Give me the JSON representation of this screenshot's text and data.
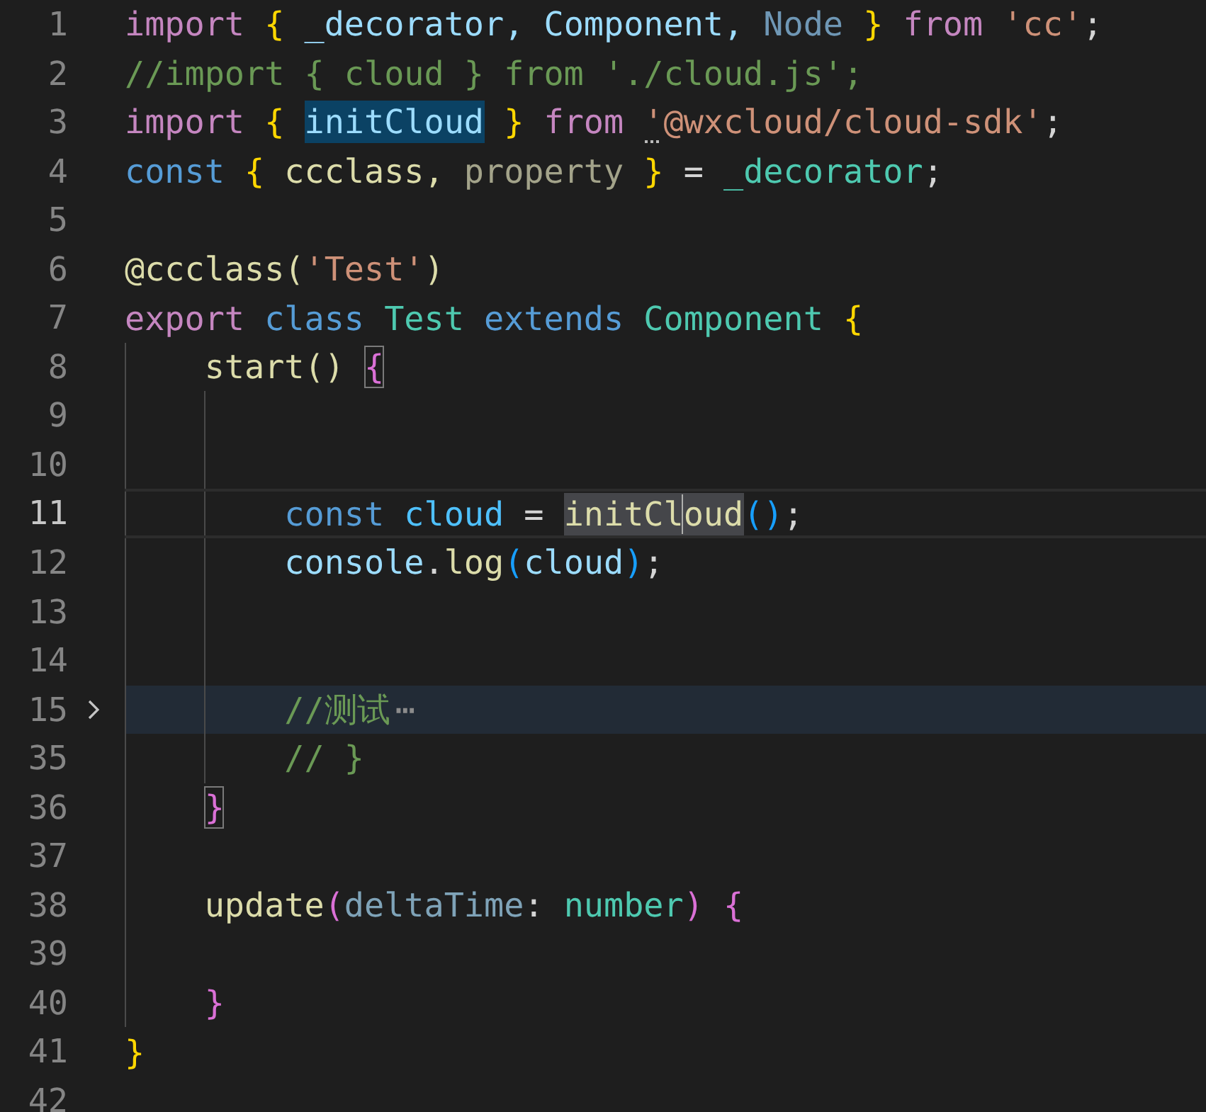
{
  "editor": {
    "lines": [
      {
        "number": "1",
        "current": false,
        "folded": false,
        "tokens": [
          {
            "text": "import",
            "kind": "keyword"
          },
          {
            "text": " {",
            "kind": "brace1"
          },
          {
            "text": " _decorator,",
            "kind": "var"
          },
          {
            "text": " Component,",
            "kind": "var"
          },
          {
            "text": " Node",
            "kind": "faded_var"
          },
          {
            "text": " }",
            "kind": "brace1"
          },
          {
            "text": " from",
            "kind": "keyword"
          },
          {
            "text": " 'cc'",
            "kind": "string"
          },
          {
            "text": ";",
            "kind": "plain"
          }
        ]
      },
      {
        "number": "2",
        "current": false,
        "folded": false,
        "tokens": [
          {
            "text": "//import { cloud } from './cloud.js';",
            "kind": "comment"
          }
        ]
      },
      {
        "number": "3",
        "current": false,
        "folded": false,
        "tokens": [
          {
            "text": "import",
            "kind": "keyword"
          },
          {
            "text": " { ",
            "kind": "brace1"
          },
          {
            "text": "initCloud",
            "kind": "var",
            "match": true
          },
          {
            "text": " }",
            "kind": "brace1"
          },
          {
            "text": " from ",
            "kind": "keyword"
          },
          {
            "text": "'@wxcloud/cloud-sdk'",
            "kind": "string",
            "hint": true
          },
          {
            "text": ";",
            "kind": "plain"
          }
        ]
      },
      {
        "number": "4",
        "current": false,
        "folded": false,
        "tokens": [
          {
            "text": "const",
            "kind": "storage"
          },
          {
            "text": " {",
            "kind": "brace1"
          },
          {
            "text": " ccclass,",
            "kind": "func"
          },
          {
            "text": " property",
            "kind": "faded_func"
          },
          {
            "text": " }",
            "kind": "brace1"
          },
          {
            "text": " =",
            "kind": "plain"
          },
          {
            "text": " _decorator",
            "kind": "type"
          },
          {
            "text": ";",
            "kind": "plain"
          }
        ]
      },
      {
        "number": "5",
        "current": false,
        "folded": false
      },
      {
        "number": "6",
        "current": false,
        "folded": false,
        "tokens": [
          {
            "text": "@ccclass(",
            "kind": "func"
          },
          {
            "text": "'Test'",
            "kind": "string"
          },
          {
            "text": ")",
            "kind": "func"
          }
        ]
      },
      {
        "number": "7",
        "current": false,
        "folded": false,
        "tokens": [
          {
            "text": "export",
            "kind": "keyword"
          },
          {
            "text": " class",
            "kind": "storage"
          },
          {
            "text": " Test",
            "kind": "type"
          },
          {
            "text": " extends",
            "kind": "storage"
          },
          {
            "text": " Component",
            "kind": "type"
          },
          {
            "text": " {",
            "kind": "brace1"
          }
        ],
        "children": [
          {
            "number": "8",
            "current": false,
            "folded": false,
            "tokens": [
              {
                "text": "start() ",
                "kind": "func"
              },
              {
                "text": "{",
                "kind": "brace2",
                "bracket_match": true
              }
            ],
            "children": [
              {
                "number": "9",
                "current": false,
                "folded": false
              },
              {
                "number": "10",
                "current": false,
                "folded": false
              },
              {
                "number": "11",
                "current": true,
                "folded": false,
                "tokens": [
                  {
                    "text": "const",
                    "kind": "storage"
                  },
                  {
                    "text": " cloud",
                    "kind": "const_var"
                  },
                  {
                    "text": " = ",
                    "kind": "plain"
                  },
                  {
                    "text": "initCl",
                    "kind": "func",
                    "occurrence": true,
                    "cursor": true
                  },
                  {
                    "text": "oud",
                    "kind": "func",
                    "occurrence": true
                  },
                  {
                    "text": "()",
                    "kind": "brace3"
                  },
                  {
                    "text": ";",
                    "kind": "plain"
                  }
                ]
              },
              {
                "number": "12",
                "current": false,
                "folded": false,
                "tokens": [
                  {
                    "text": "console",
                    "kind": "var"
                  },
                  {
                    "text": ".",
                    "kind": "plain"
                  },
                  {
                    "text": "log",
                    "kind": "func"
                  },
                  {
                    "text": "(",
                    "kind": "brace3"
                  },
                  {
                    "text": "cloud",
                    "kind": "var"
                  },
                  {
                    "text": ")",
                    "kind": "brace3"
                  },
                  {
                    "text": ";",
                    "kind": "plain"
                  }
                ]
              },
              {
                "number": "13",
                "current": false,
                "folded": false
              },
              {
                "number": "14",
                "current": false,
                "folded": false
              },
              {
                "number": "15",
                "current": false,
                "folded": true,
                "tokens": [
                  {
                    "text": "//测试",
                    "kind": "comment"
                  },
                  {
                    "text": "⋯",
                    "kind": "fold"
                  }
                ]
              },
              {
                "number": "35",
                "current": false,
                "folded": false,
                "tokens": [
                  {
                    "text": "// }",
                    "kind": "comment"
                  }
                ]
              }
            ]
          },
          {
            "number": "36",
            "current": false,
            "folded": false,
            "tokens": [
              {
                "text": "}",
                "kind": "brace2",
                "bracket_match": true
              }
            ]
          },
          {
            "number": "37",
            "current": false,
            "folded": false
          },
          {
            "number": "38",
            "current": false,
            "folded": false,
            "tokens": [
              {
                "text": "update",
                "kind": "func"
              },
              {
                "text": "(",
                "kind": "brace2"
              },
              {
                "text": "deltaTime",
                "kind": "faded_param"
              },
              {
                "text": ":",
                "kind": "plain"
              },
              {
                "text": " number",
                "kind": "type"
              },
              {
                "text": ")",
                "kind": "brace2"
              },
              {
                "text": " {",
                "kind": "brace2"
              }
            ]
          },
          {
            "number": "39",
            "current": false,
            "folded": false
          },
          {
            "number": "40",
            "current": false,
            "folded": false,
            "tokens": [
              {
                "text": "}",
                "kind": "brace2"
              }
            ]
          }
        ]
      },
      {
        "number": "41",
        "current": false,
        "folded": false,
        "tokens": [
          {
            "text": "}",
            "kind": "brace1"
          }
        ]
      },
      {
        "number": "42",
        "current": false,
        "folded": false
      }
    ]
  }
}
